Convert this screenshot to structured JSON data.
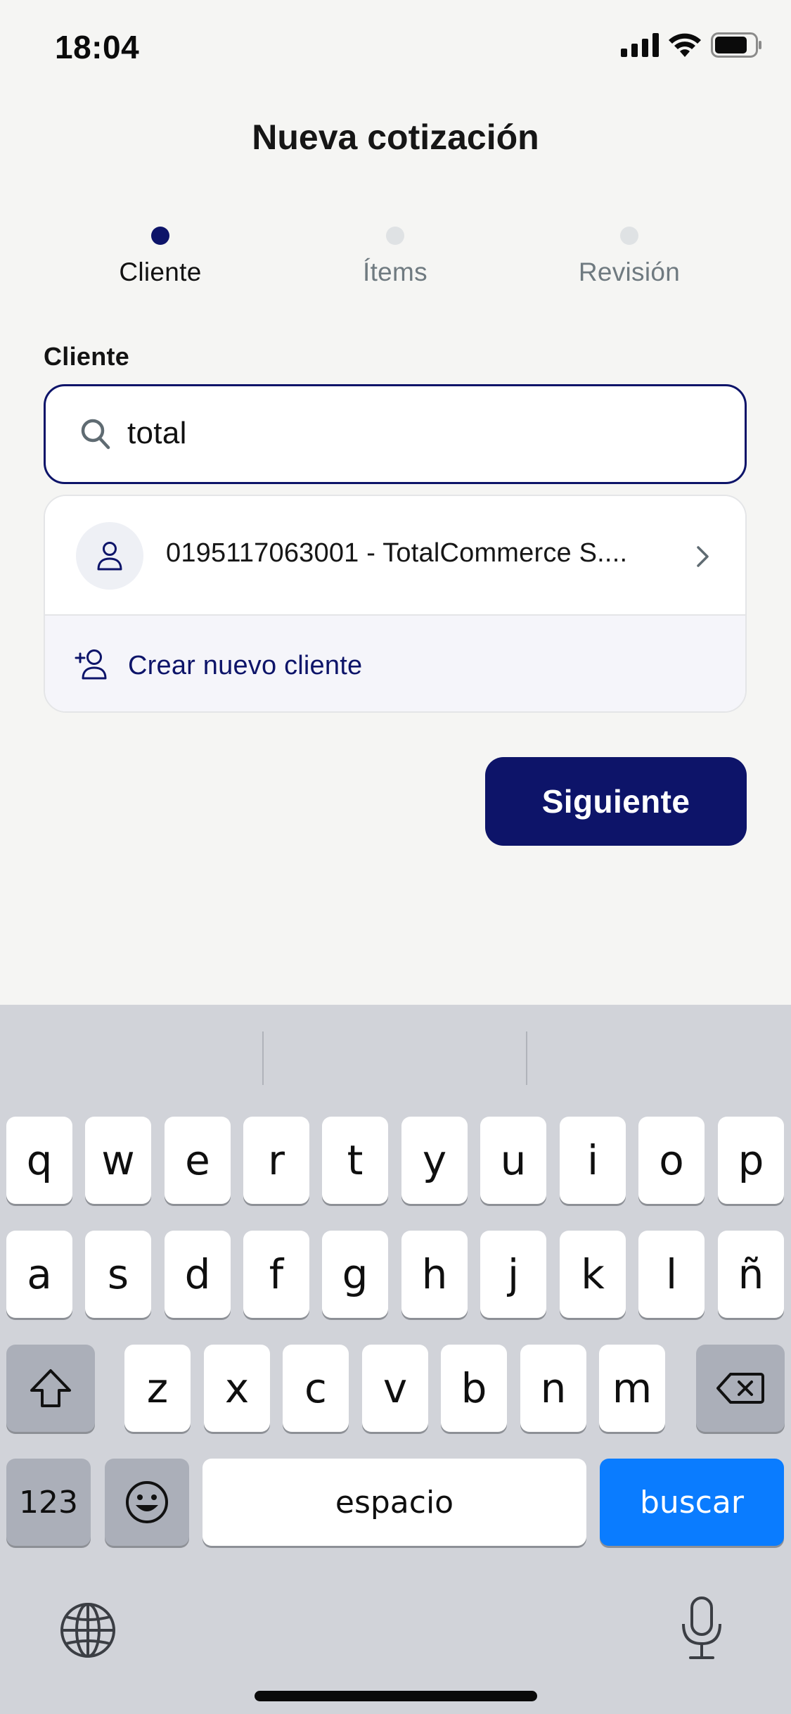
{
  "status_bar": {
    "time": "18:04"
  },
  "header": {
    "title": "Nueva cotización"
  },
  "stepper": {
    "steps": [
      {
        "label": "Cliente",
        "active": true
      },
      {
        "label": "Ítems",
        "active": false
      },
      {
        "label": "Revisión",
        "active": false
      }
    ]
  },
  "client_field": {
    "label": "Cliente",
    "search_value": "total"
  },
  "results": {
    "items": [
      {
        "text": "0195117063001 - TotalCommerce S...."
      }
    ],
    "create_label": "Crear nuevo cliente"
  },
  "actions": {
    "next_label": "Siguiente"
  },
  "keyboard": {
    "row1": [
      "q",
      "w",
      "e",
      "r",
      "t",
      "y",
      "u",
      "i",
      "o",
      "p"
    ],
    "row2": [
      "a",
      "s",
      "d",
      "f",
      "g",
      "h",
      "j",
      "k",
      "l",
      "ñ"
    ],
    "row3": [
      "z",
      "x",
      "c",
      "v",
      "b",
      "n",
      "m"
    ],
    "numbers_label": "123",
    "space_label": "espacio",
    "go_label": "buscar"
  },
  "colors": {
    "primary": "#0d1469",
    "keyboard_go": "#0a7cff"
  }
}
